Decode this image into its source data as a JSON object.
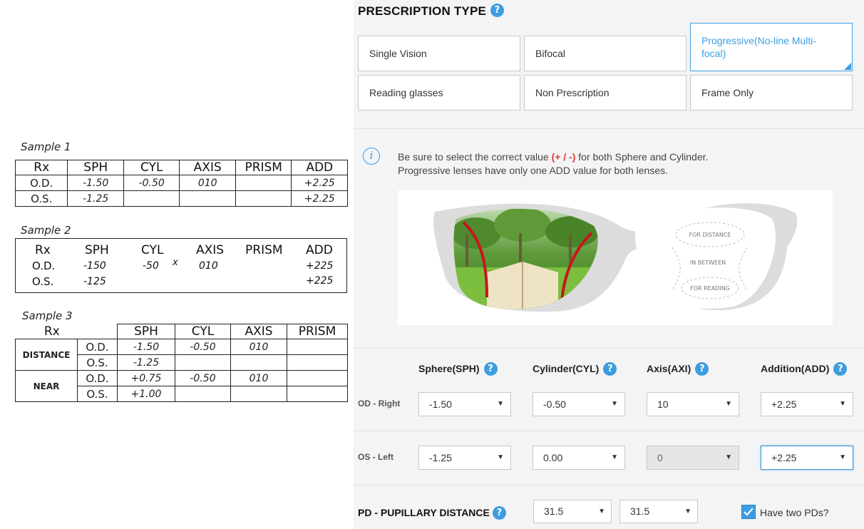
{
  "samples": {
    "s1": {
      "title": "Sample 1",
      "headers": [
        "Rx",
        "SPH",
        "CYL",
        "AXIS",
        "PRISM",
        "ADD"
      ],
      "rows": [
        {
          "label": "O.D.",
          "sph": "-1.50",
          "cyl": "-0.50",
          "axis": "010",
          "prism": "",
          "add": "+2.25"
        },
        {
          "label": "O.S.",
          "sph": "-1.25",
          "cyl": "",
          "axis": "",
          "prism": "",
          "add": "+2.25"
        }
      ]
    },
    "s2": {
      "title": "Sample 2",
      "headers": [
        "Rx",
        "SPH",
        "CYL",
        "AXIS",
        "PRISM",
        "ADD"
      ],
      "x_mark": "x",
      "rows": [
        {
          "label": "O.D.",
          "sph": "-150",
          "cyl": "-50",
          "axis": "010",
          "add": "+225"
        },
        {
          "label": "O.S.",
          "sph": "-125",
          "add": "+225"
        }
      ]
    },
    "s3": {
      "title": "Sample 3",
      "headers": [
        "Rx",
        "SPH",
        "CYL",
        "AXIS",
        "PRISM"
      ],
      "groups": [
        "DISTANCE",
        "NEAR"
      ],
      "rows": [
        {
          "label": "O.D.",
          "sph": "-1.50",
          "cyl": "-0.50",
          "axis": "010",
          "prism": ""
        },
        {
          "label": "O.S.",
          "sph": "-1.25",
          "cyl": "",
          "axis": "",
          "prism": ""
        },
        {
          "label": "O.D.",
          "sph": "+0.75",
          "cyl": "-0.50",
          "axis": "010",
          "prism": ""
        },
        {
          "label": "O.S.",
          "sph": "+1.00",
          "cyl": "",
          "axis": "",
          "prism": ""
        }
      ]
    }
  },
  "prescription": {
    "title": "PRESCRIPTION TYPE",
    "help": "?",
    "options": [
      "Single Vision",
      "Bifocal",
      "Progressive(No-line Multi-focal)",
      "Reading glasses",
      "Non Prescription",
      "Frame Only"
    ],
    "selected": "Progressive(No-line Multi-focal)"
  },
  "info": {
    "icon": "i",
    "line1_before": "Be sure to select the correct value ",
    "line1_pm": "(+ / -)",
    "line1_after": " for both Sphere and Cylinder.",
    "line2": "Progressive lenses have only one ADD value for both lenses."
  },
  "lens_diagram": {
    "zones": [
      "FOR DISTANCE",
      "IN BETWEEN",
      "FOR READING"
    ]
  },
  "rx_form": {
    "columns": [
      "Sphere(SPH)",
      "Cylinder(CYL)",
      "Axis(AXI)",
      "Addition(ADD)"
    ],
    "rows": [
      {
        "label": "OD - Right",
        "sph": "-1.50",
        "cyl": "-0.50",
        "axis": "10",
        "add": "+2.25"
      },
      {
        "label": "OS - Left",
        "sph": "-1.25",
        "cyl": "0.00",
        "axis": "0",
        "add": "+2.25"
      }
    ]
  },
  "pd": {
    "title": "PD - PUPILLARY DISTANCE",
    "left": "31.5",
    "right": "31.5",
    "two_pds_label": "Have two PDs?",
    "two_pds_checked": true
  },
  "colors": {
    "accent": "#3d9ddf",
    "warning": "#e53935",
    "panel_bg": "#f4f4f4"
  }
}
